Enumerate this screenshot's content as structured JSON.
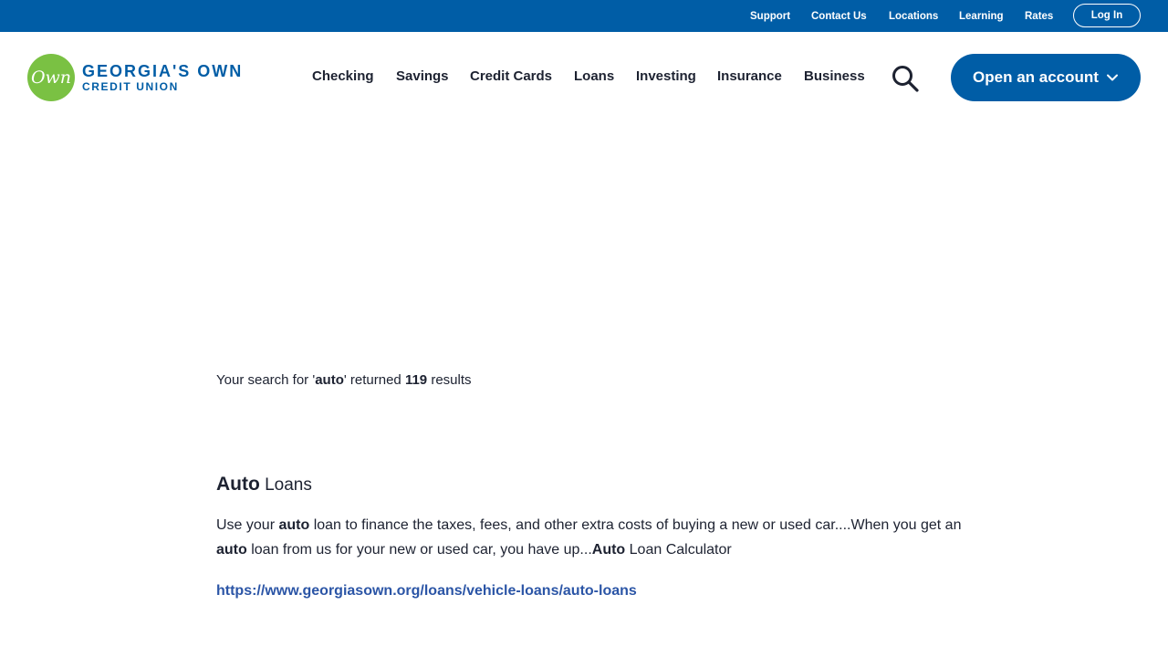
{
  "utility_nav": {
    "links": [
      "Support",
      "Contact Us",
      "Locations",
      "Learning",
      "Rates"
    ],
    "login_label": "Log In"
  },
  "header": {
    "logo": {
      "mark": "Own",
      "name": "GEORGIA'S OWN",
      "sub": "CREDIT UNION"
    },
    "nav": [
      "Checking",
      "Savings",
      "Credit Cards",
      "Loans",
      "Investing",
      "Insurance",
      "Business"
    ],
    "search_icon": "search-icon",
    "open_account_label": "Open an account",
    "open_account_icon": "chevron-down-icon"
  },
  "search": {
    "prefix": "Your search for '",
    "query": "auto",
    "middle": "' returned ",
    "count": "119",
    "suffix": " results"
  },
  "results": [
    {
      "title_highlight": "Auto",
      "title_rest": " Loans",
      "snippet_parts": [
        {
          "text": "Use your ",
          "bold": false
        },
        {
          "text": "auto",
          "bold": true
        },
        {
          "text": " loan to finance the taxes, fees, and other extra costs of buying a new or used car....When you get an ",
          "bold": false
        },
        {
          "text": "auto",
          "bold": true
        },
        {
          "text": " loan from us for your new or used car, you have up...",
          "bold": false
        },
        {
          "text": "Auto",
          "bold": true
        },
        {
          "text": " Loan Calculator",
          "bold": false
        }
      ],
      "url": "https://www.georgiasown.org/loans/vehicle-loans/auto-loans"
    }
  ],
  "colors": {
    "brand_blue": "#005da6",
    "brand_green": "#7ac143",
    "link_blue": "#2b55a6",
    "text_dark": "#1d2231"
  }
}
